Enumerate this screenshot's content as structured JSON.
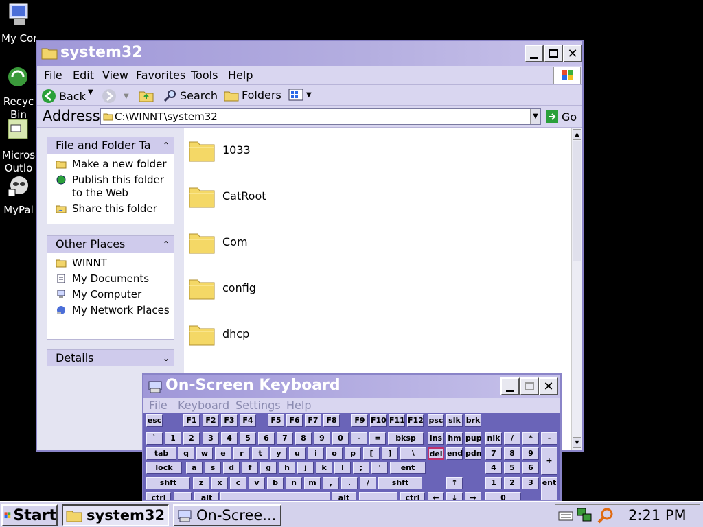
{
  "desktop_icons": [
    {
      "name": "my-computer",
      "label": "My Compu",
      "label2": ""
    },
    {
      "name": "recycle-bin",
      "label": "Recyc",
      "label2": "Bin"
    },
    {
      "name": "outlook",
      "label": "Micros",
      "label2": "Outlo"
    },
    {
      "name": "mypal",
      "label": "MyPal",
      "label2": ""
    }
  ],
  "explorer": {
    "title": "system32",
    "menu": [
      "File",
      "Edit",
      "View",
      "Favorites",
      "Tools",
      "Help"
    ],
    "toolbar": {
      "back": "Back",
      "search": "Search",
      "folders": "Folders"
    },
    "address_label": "Address",
    "address_value": "C:\\WINNT\\system32",
    "go_label": "Go",
    "tasks_panel": {
      "title": "File and Folder Ta",
      "items": [
        "Make a new folder",
        "Publish this folder to the Web",
        "Share this folder"
      ]
    },
    "places_panel": {
      "title": "Other Places",
      "items": [
        "WINNT",
        "My Documents",
        "My Computer",
        "My Network Places"
      ]
    },
    "details_panel": {
      "title": "Details"
    },
    "folders": [
      "1033",
      "CatRoot",
      "Com",
      "config",
      "dhcp"
    ]
  },
  "osk": {
    "title": "On-Screen Keyboard",
    "menu": [
      "File",
      "Keyboard",
      "Settings",
      "Help"
    ],
    "rows": [
      [
        "esc",
        "F1",
        "F2",
        "F3",
        "F4",
        "F5",
        "F6",
        "F7",
        "F8",
        "F9",
        "F10",
        "F11",
        "F12",
        "psc",
        "slk",
        "brk"
      ],
      [
        "`",
        "1",
        "2",
        "3",
        "4",
        "5",
        "6",
        "7",
        "8",
        "9",
        "0",
        "-",
        "=",
        "bksp",
        "ins",
        "hm",
        "pup",
        "nlk",
        "/",
        "*",
        "-"
      ],
      [
        "tab",
        "q",
        "w",
        "e",
        "r",
        "t",
        "y",
        "u",
        "i",
        "o",
        "p",
        "[",
        "]",
        "\\",
        "del",
        "end",
        "pdn",
        "7",
        "8",
        "9",
        "+"
      ],
      [
        "lock",
        "a",
        "s",
        "d",
        "f",
        "g",
        "h",
        "j",
        "k",
        "l",
        ";",
        "'",
        "ent",
        "4",
        "5",
        "6"
      ],
      [
        "shft",
        "z",
        "x",
        "c",
        "v",
        "b",
        "n",
        "m",
        ",",
        ".",
        "/",
        "shft",
        "↑",
        "1",
        "2",
        "3",
        "ent"
      ],
      [
        "ctrl",
        "alt",
        "alt",
        "ctrl",
        "←",
        "↓",
        "→",
        "0"
      ]
    ]
  },
  "taskbar": {
    "start": "Start",
    "tasks": [
      "system32",
      "On-Scree..."
    ],
    "clock": "2:21 PM"
  },
  "colors": {
    "title_start": "#9f97d8",
    "title_end": "#c8c2ea",
    "window_bg": "#e8e8f4",
    "osk_bg": "#6a64b8"
  }
}
